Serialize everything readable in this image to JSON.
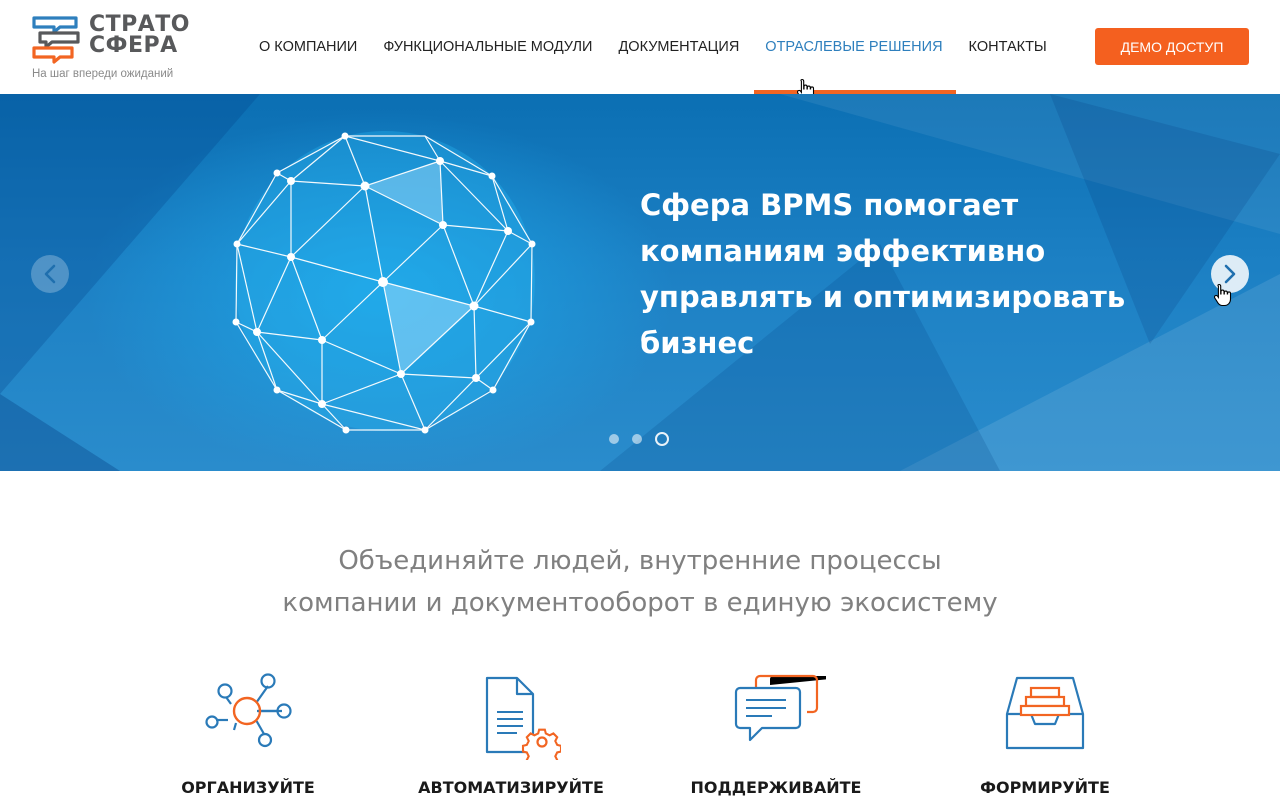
{
  "header": {
    "logo": {
      "line1": "СТРАТО",
      "line2": "СФЕРА",
      "tagline": "На шаг впереди ожиданий"
    },
    "nav": [
      {
        "label": "О КОМПАНИИ"
      },
      {
        "label": "ФУНКЦИОНАЛЬНЫЕ МОДУЛИ"
      },
      {
        "label": "ДОКУМЕНТАЦИЯ"
      },
      {
        "label": "ОТРАСЛЕВЫЕ РЕШЕНИЯ",
        "active": true
      },
      {
        "label": "КОНТАКТЫ"
      }
    ],
    "demo_label": "ДЕМО ДОСТУП"
  },
  "hero": {
    "title": "Сфера BPMS помогает компаниям эффективно управлять и оптимизировать бизнес",
    "slides_total": 3,
    "active_slide": 3
  },
  "intro": {
    "line1": "Объединяйте людей, внутренние процессы",
    "line2": "компании и документооборот в единую экосистему"
  },
  "features": [
    {
      "label": "ОРГАНИЗУЙТЕ",
      "icon": "network-icon"
    },
    {
      "label": "АВТОМАТИЗИРУЙТЕ",
      "icon": "document-gear-icon"
    },
    {
      "label": "ПОДДЕРЖИВАЙТЕ",
      "icon": "chat-bubbles-icon"
    },
    {
      "label": "ФОРМИРУЙТЕ",
      "icon": "archive-tray-icon"
    }
  ],
  "colors": {
    "accent": "#f4601f",
    "nav_active": "#2e7fbd",
    "icon_blue": "#2a7ab8",
    "hero_blue": "#1c80c4"
  }
}
